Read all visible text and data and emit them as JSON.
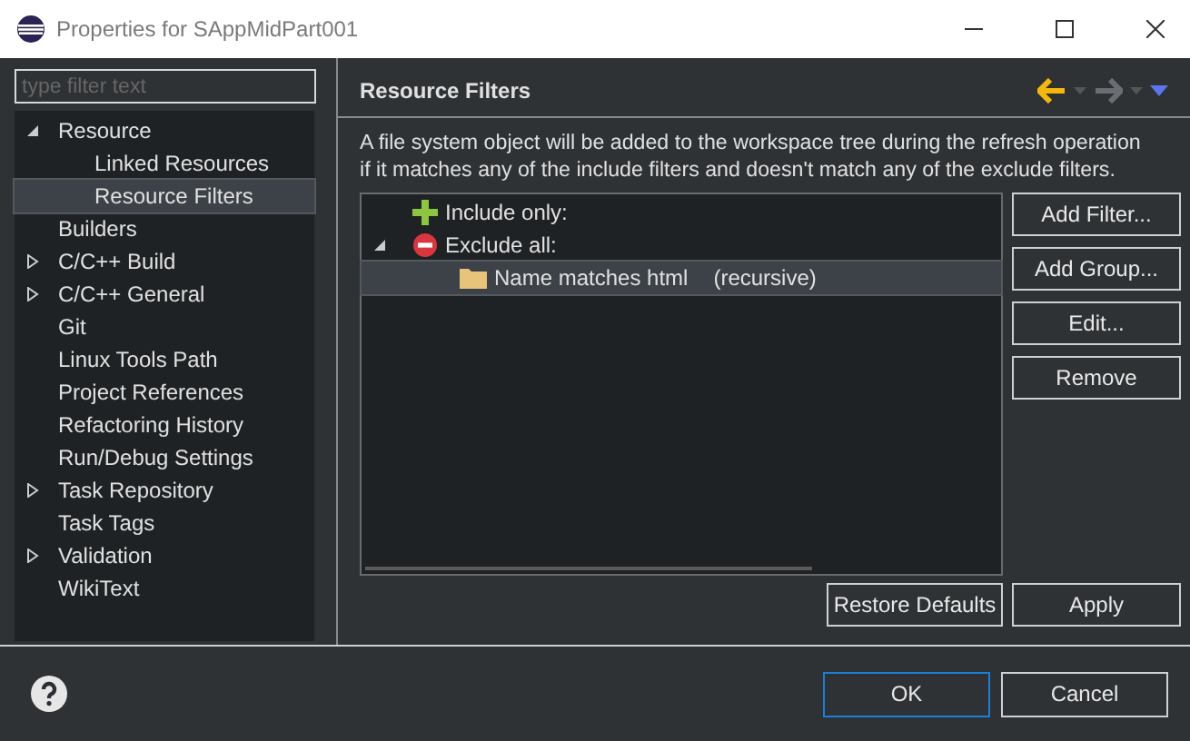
{
  "window": {
    "title": "Properties for SAppMidPart001"
  },
  "sidebar": {
    "filter": {
      "placeholder": "type filter text"
    },
    "items": [
      {
        "label": "Resource",
        "expanded": true,
        "selected": false,
        "children": [
          {
            "label": "Linked Resources",
            "selected": false
          },
          {
            "label": "Resource Filters",
            "selected": true
          }
        ]
      },
      {
        "label": "Builders",
        "selected": false
      },
      {
        "label": "C/C++ Build",
        "expanded": false,
        "selected": false
      },
      {
        "label": "C/C++ General",
        "expanded": false,
        "selected": false
      },
      {
        "label": "Git",
        "selected": false
      },
      {
        "label": "Linux Tools Path",
        "selected": false
      },
      {
        "label": "Project References",
        "selected": false
      },
      {
        "label": "Refactoring History",
        "selected": false
      },
      {
        "label": "Run/Debug Settings",
        "selected": false
      },
      {
        "label": "Task Repository",
        "expanded": false,
        "selected": false
      },
      {
        "label": "Task Tags",
        "selected": false
      },
      {
        "label": "Validation",
        "expanded": false,
        "selected": false
      },
      {
        "label": "WikiText",
        "selected": false
      }
    ]
  },
  "page": {
    "title": "Resource Filters",
    "description": "A file system object will be added to the workspace tree during the refresh operation if it matches any of the include filters and doesn't match any of the exclude filters.",
    "filters": [
      {
        "kind": "include",
        "label": "Include only:",
        "selected": false
      },
      {
        "kind": "exclude",
        "label": "Exclude all:",
        "expanded": true,
        "selected": false,
        "children": [
          {
            "kind": "folder",
            "label": "Name matches html",
            "detail": "(recursive)",
            "selected": true
          }
        ]
      }
    ],
    "side_buttons": [
      "Add Filter...",
      "Add Group...",
      "Edit...",
      "Remove"
    ],
    "bottom_buttons": [
      "Restore Defaults",
      "Apply"
    ]
  },
  "footer": {
    "buttons": [
      {
        "label": "OK",
        "default": true
      },
      {
        "label": "Cancel",
        "default": false
      }
    ]
  }
}
